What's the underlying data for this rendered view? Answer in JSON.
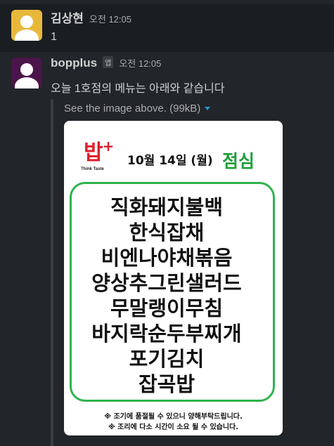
{
  "messages": [
    {
      "author": "김상현",
      "time": "오전 12:05",
      "text": "1"
    },
    {
      "author": "bopplus",
      "badge": "앱",
      "time": "오전 12:05",
      "text": "오늘 1호점의 메뉴는 아래와 같습니다",
      "attachment": {
        "caption": "See the image above. (99kB)",
        "image": {
          "logo": "밥",
          "logo_plus": "+",
          "tagline": "Think Taste",
          "date": "10월 14일 (월)",
          "meal": "점심",
          "menu": [
            "직화돼지불백",
            "한식잡채",
            "비엔나야채볶음",
            "양상추그린샐러드",
            "무말랭이무침",
            "바지락순두부찌개",
            "포기김치",
            "잡곡밥"
          ],
          "notes": [
            "※  조기에 품절될 수 있으니 양해부탁드립니다.",
            "※ 조리에 다소 시간이 소요 될 수 있습니다."
          ]
        }
      }
    }
  ],
  "colors": {
    "background": "#1a1d21",
    "avatar_user": "#e8b83a",
    "avatar_bot": "#4a154b",
    "logo_red": "#e01e2b",
    "meal_green": "#1e9e3a",
    "menu_border": "#2eb34d",
    "link_blue": "#1d9bd1"
  }
}
